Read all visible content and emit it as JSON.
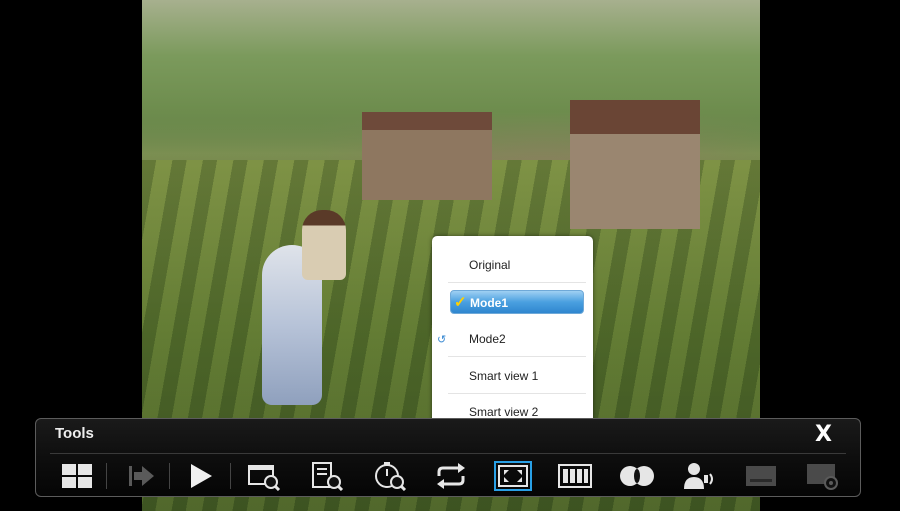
{
  "popup": {
    "items": [
      {
        "label": "Original"
      },
      {
        "label": "Mode1",
        "selected": true
      },
      {
        "label": "Mode2"
      },
      {
        "label": "Smart view 1"
      },
      {
        "label": "Smart view 2"
      }
    ],
    "check_glyph": "✓",
    "loop_glyph": "↺"
  },
  "tools": {
    "title": "Tools",
    "close_label": "X",
    "buttons": [
      {
        "icon": "grid-icon"
      },
      {
        "icon": "next-disabled-icon"
      },
      {
        "icon": "play-icon"
      },
      {
        "icon": "scene-search-icon"
      },
      {
        "icon": "title-search-icon"
      },
      {
        "icon": "time-search-icon"
      },
      {
        "icon": "repeat-icon"
      },
      {
        "icon": "picture-size-icon",
        "active": true
      },
      {
        "icon": "picture-mode-icon"
      },
      {
        "icon": "sound-mode-icon"
      },
      {
        "icon": "audio-language-icon"
      },
      {
        "icon": "subtitle-disabled-icon"
      },
      {
        "icon": "settings-disabled-icon"
      }
    ]
  },
  "colors": {
    "accent": "#29a0e6",
    "selection": "#4aa0e0",
    "check": "#ffd000"
  }
}
